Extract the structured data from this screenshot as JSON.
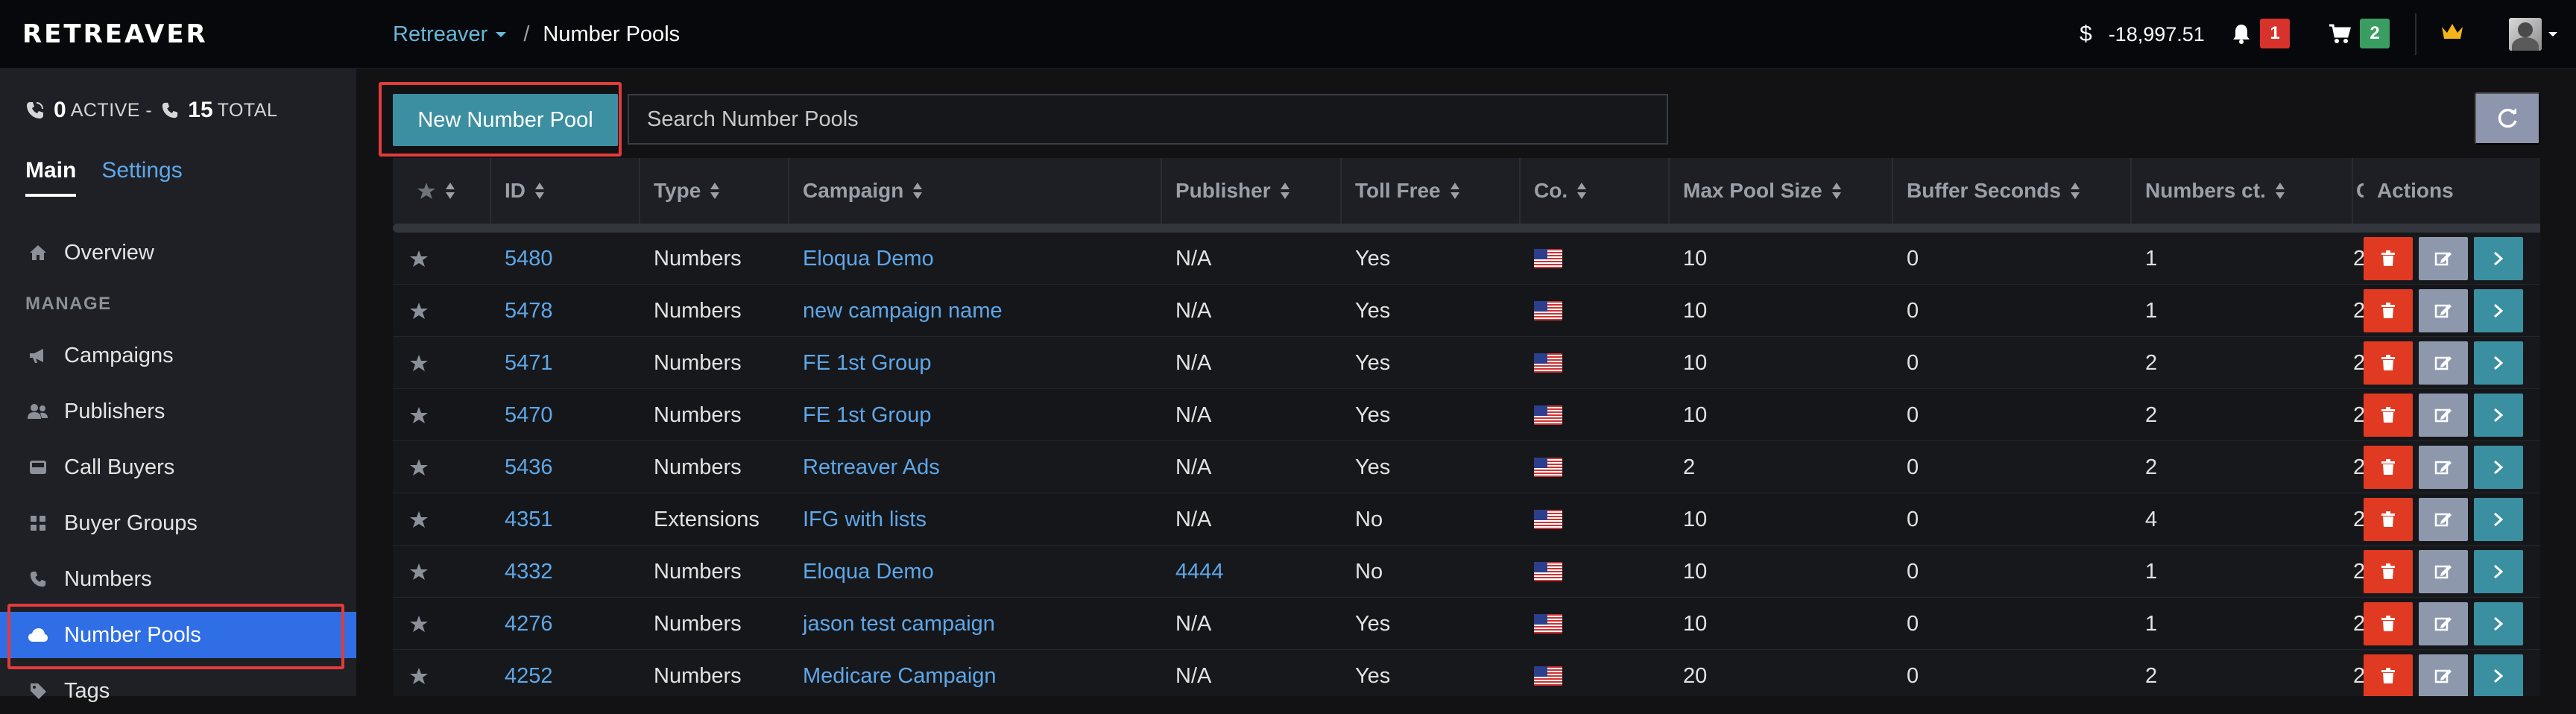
{
  "app": {
    "logo": "RETREAVER"
  },
  "breadcrumb": {
    "root": "Retreaver",
    "current": "Number Pools"
  },
  "header": {
    "balance": "-18,997.51",
    "currency_symbol": "$",
    "notifications_count": "1",
    "cart_count": "2"
  },
  "sidebar": {
    "calls": {
      "active": "0",
      "active_label": "ACTIVE -",
      "total": "15",
      "total_label": "TOTAL"
    },
    "tabs": {
      "main": "Main",
      "settings": "Settings"
    },
    "overview": "Overview",
    "section_manage": "MANAGE",
    "items": [
      "Campaigns",
      "Publishers",
      "Call Buyers",
      "Buyer Groups",
      "Numbers",
      "Number Pools",
      "Tags"
    ],
    "active_item": "Number Pools"
  },
  "toolbar": {
    "new_button": "New Number Pool",
    "search_placeholder": "Search Number Pools"
  },
  "table": {
    "columns": [
      "ID",
      "Type",
      "Campaign",
      "Publisher",
      "Toll Free",
      "Co.",
      "Max Pool Size",
      "Buffer Seconds",
      "Numbers ct.",
      "C",
      "Actions"
    ],
    "rows": [
      {
        "id": "5480",
        "type": "Numbers",
        "campaign": "Eloqua Demo",
        "publisher": "N/A",
        "toll_free": "Yes",
        "max_pool": "10",
        "buffer": "0",
        "numbers_ct": "1",
        "c": "2"
      },
      {
        "id": "5478",
        "type": "Numbers",
        "campaign": "new campaign name",
        "publisher": "N/A",
        "toll_free": "Yes",
        "max_pool": "10",
        "buffer": "0",
        "numbers_ct": "1",
        "c": "2"
      },
      {
        "id": "5471",
        "type": "Numbers",
        "campaign": "FE 1st Group",
        "publisher": "N/A",
        "toll_free": "Yes",
        "max_pool": "10",
        "buffer": "0",
        "numbers_ct": "2",
        "c": "2"
      },
      {
        "id": "5470",
        "type": "Numbers",
        "campaign": "FE 1st Group",
        "publisher": "N/A",
        "toll_free": "Yes",
        "max_pool": "10",
        "buffer": "0",
        "numbers_ct": "2",
        "c": "2"
      },
      {
        "id": "5436",
        "type": "Numbers",
        "campaign": "Retreaver Ads",
        "publisher": "N/A",
        "toll_free": "Yes",
        "max_pool": "2",
        "buffer": "0",
        "numbers_ct": "2",
        "c": "2"
      },
      {
        "id": "4351",
        "type": "Extensions",
        "campaign": "IFG with lists",
        "publisher": "N/A",
        "toll_free": "No",
        "max_pool": "10",
        "buffer": "0",
        "numbers_ct": "4",
        "c": "2"
      },
      {
        "id": "4332",
        "type": "Numbers",
        "campaign": "Eloqua Demo",
        "publisher": "4444",
        "toll_free": "No",
        "max_pool": "10",
        "buffer": "0",
        "numbers_ct": "1",
        "c": "2"
      },
      {
        "id": "4276",
        "type": "Numbers",
        "campaign": "jason test campaign",
        "publisher": "N/A",
        "toll_free": "Yes",
        "max_pool": "10",
        "buffer": "0",
        "numbers_ct": "1",
        "c": "2"
      },
      {
        "id": "4252",
        "type": "Numbers",
        "campaign": "Medicare Campaign",
        "publisher": "N/A",
        "toll_free": "Yes",
        "max_pool": "20",
        "buffer": "0",
        "numbers_ct": "2",
        "c": "2"
      }
    ]
  },
  "colors": {
    "accent": "#2f6ee5",
    "link": "#5ea7e8",
    "delete": "#e03a22",
    "edit": "#8e98ad",
    "go": "#3a8fa0",
    "highlight": "#e23b3b"
  }
}
